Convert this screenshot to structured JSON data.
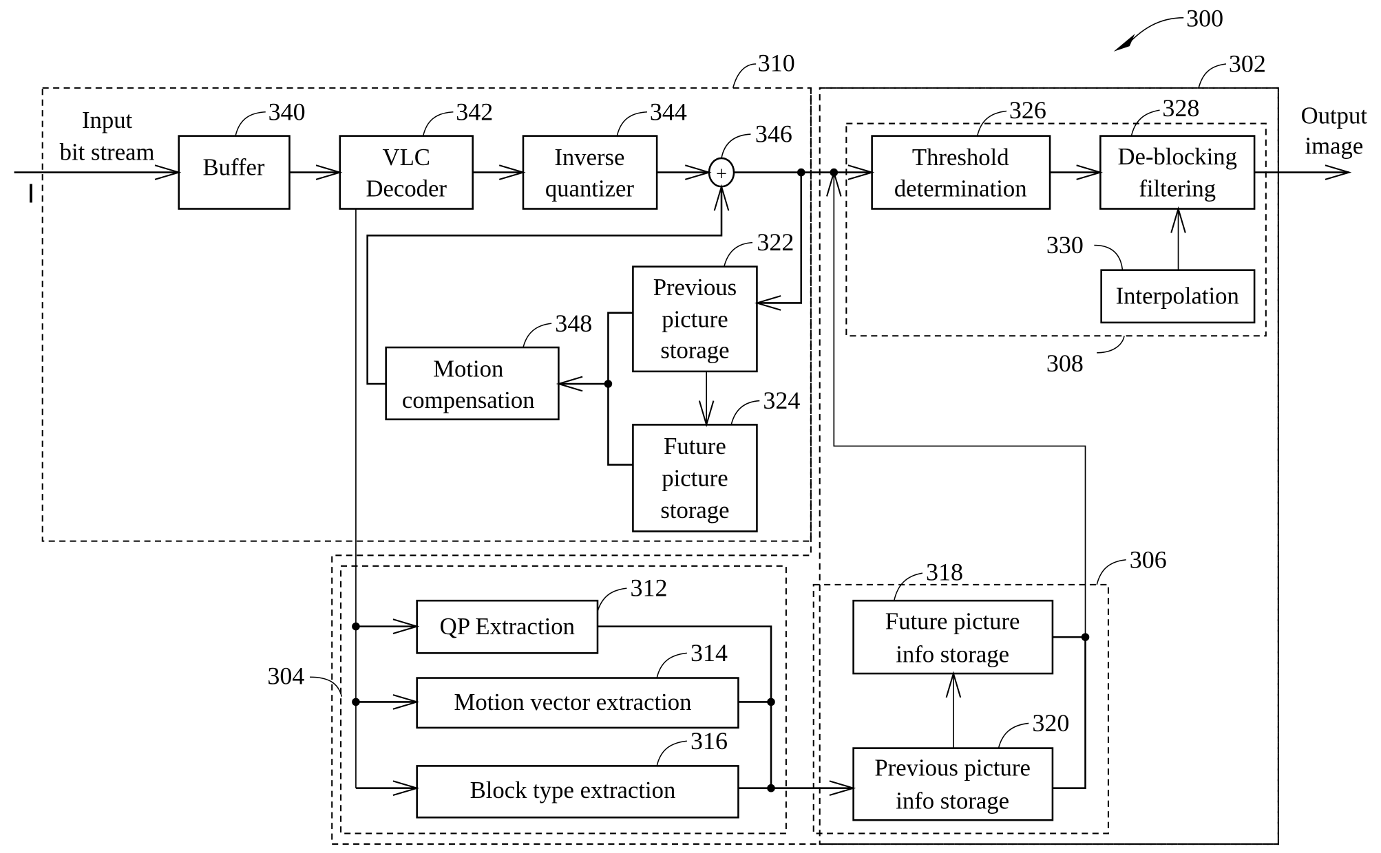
{
  "figure": {
    "ref": "300",
    "input_label": [
      "Input",
      "bit stream"
    ],
    "output_label": [
      "Output",
      "image"
    ],
    "groups": [
      {
        "id": "decoder",
        "ref": "310"
      },
      {
        "id": "deblocking-unit",
        "ref": "302"
      },
      {
        "id": "filter-module",
        "ref": "308"
      },
      {
        "id": "info-extractor",
        "ref": "304"
      },
      {
        "id": "info-storage",
        "ref": "306"
      }
    ],
    "blocks": {
      "buffer": {
        "ref": "340",
        "lines": [
          "Buffer"
        ]
      },
      "vlc_decoder": {
        "ref": "342",
        "lines": [
          "VLC",
          "Decoder"
        ]
      },
      "inverse_quantizer": {
        "ref": "344",
        "lines": [
          "Inverse",
          "quantizer"
        ]
      },
      "adder": {
        "ref": "346",
        "symbol": "+"
      },
      "previous_picture_storage": {
        "ref": "322",
        "lines": [
          "Previous",
          "picture",
          "storage"
        ]
      },
      "motion_compensation": {
        "ref": "348",
        "lines": [
          "Motion",
          "compensation"
        ]
      },
      "future_picture_storage": {
        "ref": "324",
        "lines": [
          "Future",
          "picture",
          "storage"
        ]
      },
      "threshold_determination": {
        "ref": "326",
        "lines": [
          "Threshold",
          "determination"
        ]
      },
      "deblocking_filtering": {
        "ref": "328",
        "lines": [
          "De-blocking",
          "filtering"
        ]
      },
      "interpolation": {
        "ref": "330",
        "lines": [
          "Interpolation"
        ]
      },
      "qp_extraction": {
        "ref": "312",
        "lines": [
          "QP Extraction"
        ]
      },
      "motion_vector_extraction": {
        "ref": "314",
        "lines": [
          "Motion vector extraction"
        ]
      },
      "block_type_extraction": {
        "ref": "316",
        "lines": [
          "Block type extraction"
        ]
      },
      "future_picture_info_storage": {
        "ref": "318",
        "lines": [
          "Future picture",
          "info storage"
        ]
      },
      "previous_picture_info_storage": {
        "ref": "320",
        "lines": [
          "Previous picture",
          "info storage"
        ]
      }
    }
  }
}
